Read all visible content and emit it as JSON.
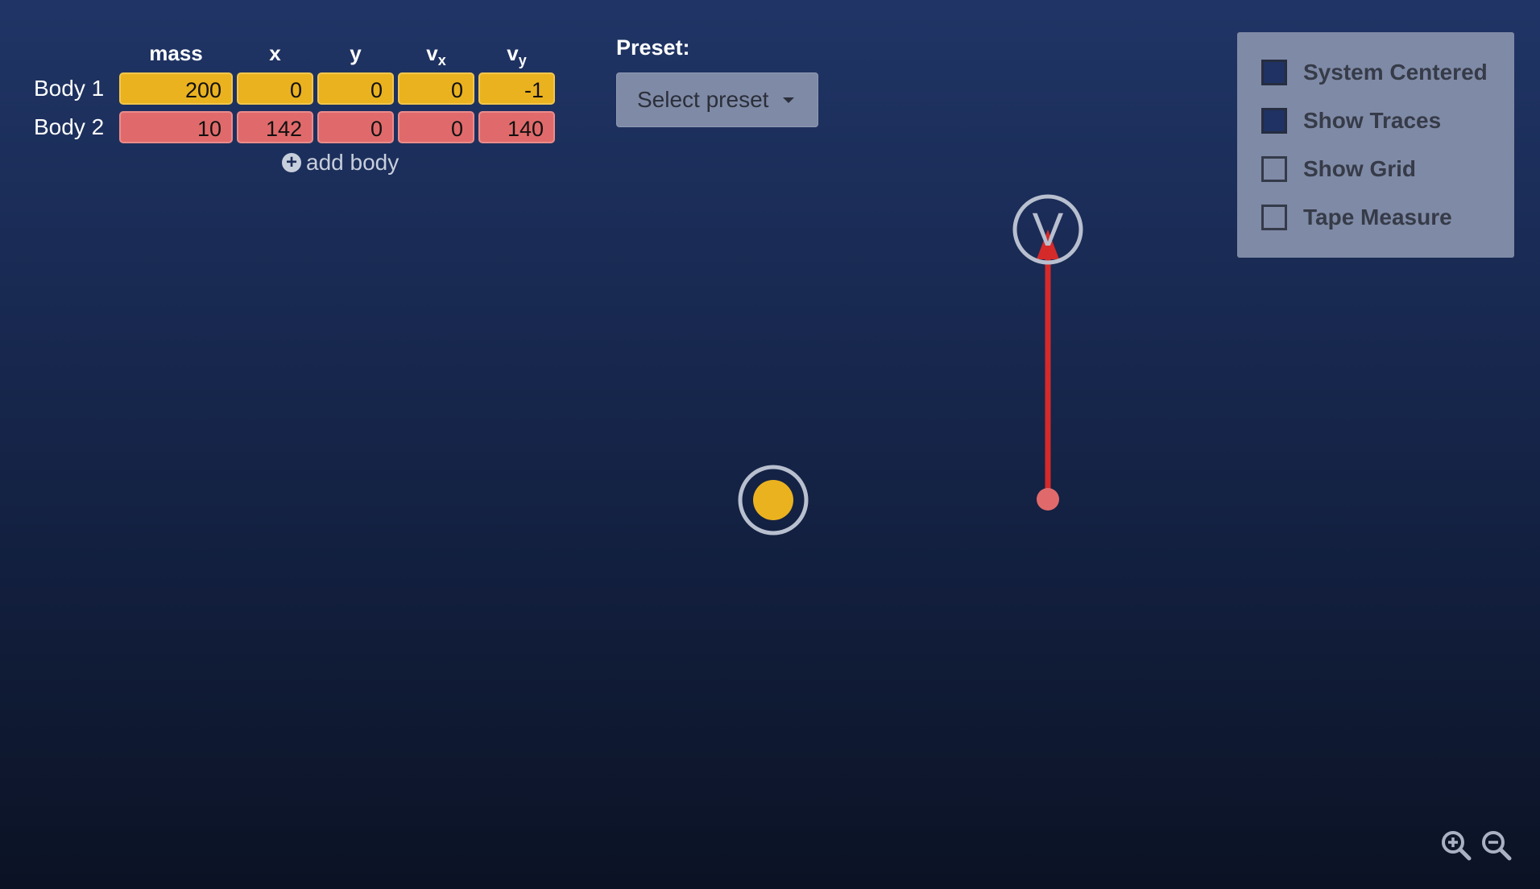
{
  "table": {
    "headers": {
      "mass": "mass",
      "x": "x",
      "y": "y",
      "vx_base": "v",
      "vx_sub": "x",
      "vy_base": "v",
      "vy_sub": "y"
    },
    "bodies": [
      {
        "label": "Body 1",
        "mass": "200",
        "x": "0",
        "y": "0",
        "vx": "0",
        "vy": "-1",
        "color": "#eab21f"
      },
      {
        "label": "Body 2",
        "mass": "10",
        "x": "142",
        "y": "0",
        "vx": "0",
        "vy": "140",
        "color": "#e06a6b"
      }
    ],
    "add_body_label": "add body"
  },
  "preset": {
    "label": "Preset:",
    "select_value": "Select preset"
  },
  "options": [
    {
      "label": "System Centered",
      "checked": true
    },
    {
      "label": "Show Traces",
      "checked": true
    },
    {
      "label": "Show Grid",
      "checked": false
    },
    {
      "label": "Tape Measure",
      "checked": false
    }
  ],
  "zoom": {
    "in_icon": "zoom-in-icon",
    "out_icon": "zoom-out-icon"
  },
  "colors": {
    "background_top": "#203566",
    "background_bottom": "#0b1224",
    "body1": "#eab21f",
    "body2": "#e06a6b",
    "velocity_arrow": "#d42a2a",
    "panel": "#7f8aa6"
  },
  "velocity_handle_label": "V"
}
